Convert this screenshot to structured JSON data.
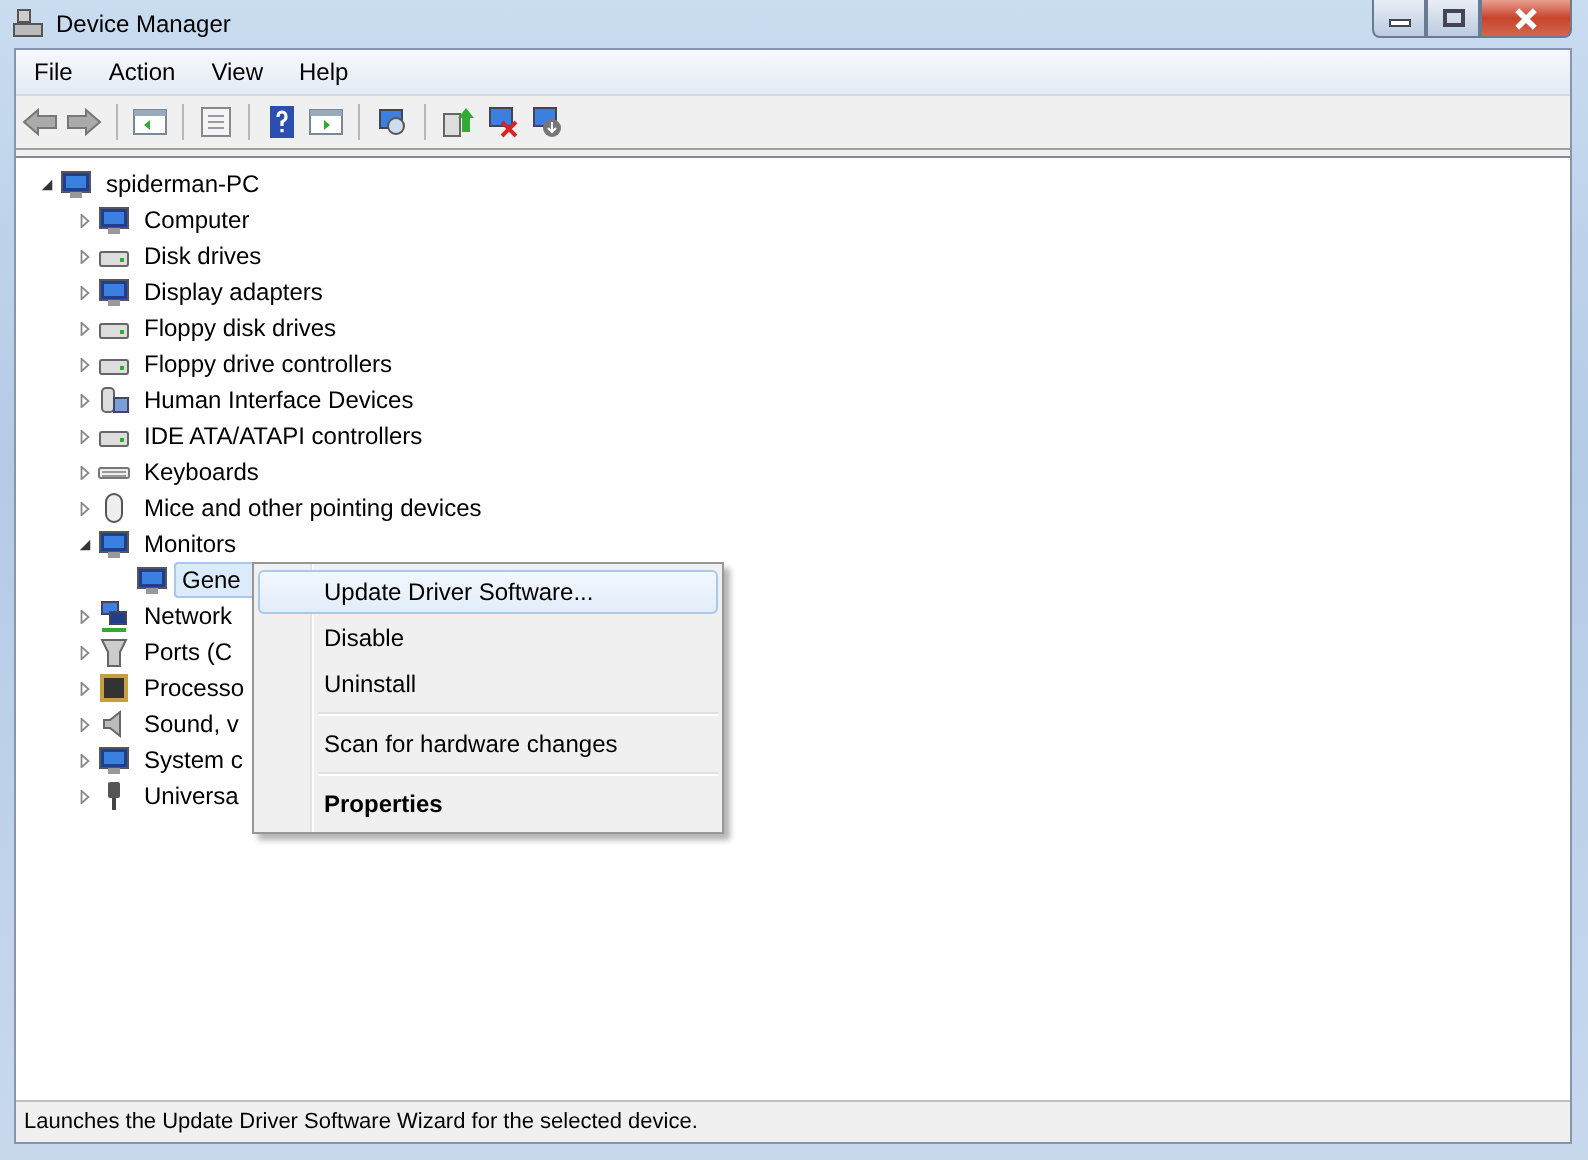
{
  "window": {
    "title": "Device Manager"
  },
  "menu_bar": [
    "File",
    "Action",
    "View",
    "Help"
  ],
  "tree": {
    "label": "spiderman-PC",
    "expanded": true,
    "selected": false,
    "children": [
      {
        "label": "Computer",
        "expanded": false,
        "selected": false
      },
      {
        "label": "Disk drives",
        "expanded": false,
        "selected": false
      },
      {
        "label": "Display adapters",
        "expanded": false,
        "selected": false
      },
      {
        "label": "Floppy disk drives",
        "expanded": false,
        "selected": false
      },
      {
        "label": "Floppy drive controllers",
        "expanded": false,
        "selected": false
      },
      {
        "label": "Human Interface Devices",
        "expanded": false,
        "selected": false
      },
      {
        "label": "IDE ATA/ATAPI controllers",
        "expanded": false,
        "selected": false
      },
      {
        "label": "Keyboards",
        "expanded": false,
        "selected": false
      },
      {
        "label": "Mice and other pointing devices",
        "expanded": false,
        "selected": false
      },
      {
        "label": "Monitors",
        "expanded": true,
        "selected": false,
        "children": [
          {
            "label": "Gene",
            "selected": true
          }
        ]
      },
      {
        "label": "Network",
        "expanded": false,
        "selected": false
      },
      {
        "label": "Ports (C",
        "expanded": false,
        "selected": false
      },
      {
        "label": "Processo",
        "expanded": false,
        "selected": false
      },
      {
        "label": "Sound, v",
        "expanded": false,
        "selected": false
      },
      {
        "label": "System c",
        "expanded": false,
        "selected": false
      },
      {
        "label": "Universa",
        "expanded": false,
        "selected": false
      }
    ]
  },
  "context_menu": [
    {
      "label": "Update Driver Software...",
      "selected": true,
      "bold": false,
      "separator_after": false
    },
    {
      "label": "Disable",
      "selected": false,
      "bold": false,
      "separator_after": false
    },
    {
      "label": "Uninstall",
      "selected": false,
      "bold": false,
      "separator_after": true
    },
    {
      "label": "Scan for hardware changes",
      "selected": false,
      "bold": false,
      "separator_after": true
    },
    {
      "label": "Properties",
      "selected": false,
      "bold": true,
      "separator_after": false
    }
  ],
  "status_bar": "Launches the Update Driver Software Wizard for the selected device."
}
